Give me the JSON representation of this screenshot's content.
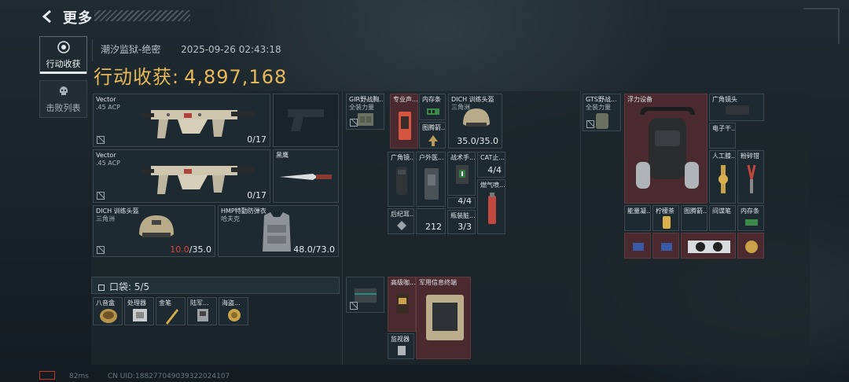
{
  "header": {
    "title": "更多"
  },
  "tabs": [
    {
      "label": "行动收获",
      "icon": "target-icon",
      "active": true
    },
    {
      "label": "击败列表",
      "icon": "skull-icon",
      "active": false
    }
  ],
  "match": {
    "map": "潮汐监狱-绝密",
    "timestamp": "2025-09-26 02:43:18"
  },
  "harvest": {
    "label": "行动收获:",
    "value": "4,897,168"
  },
  "loadout": {
    "primary1": {
      "name": "Vector",
      "ammo": ".45 ACP",
      "count": "0/17",
      "icon": "smg-icon"
    },
    "pistol": {
      "name": "",
      "icon": "pistol-icon"
    },
    "primary2": {
      "name": "Vector",
      "ammo": ".45 ACP",
      "count": "0/17",
      "icon": "smg-icon"
    },
    "melee": {
      "name": "黑鹰",
      "icon": "knife-icon"
    },
    "helmet": {
      "name": "DICH 训练头盔",
      "sub": "三角洲",
      "durability_current": "10.0",
      "durability_max": "/35.0",
      "icon": "helmet-icon"
    },
    "armor": {
      "name": "HMP特勤防弹衣",
      "sub": "哈夫克",
      "durability": "48.0/73.0",
      "icon": "armor-vest-icon"
    }
  },
  "pocket": {
    "label": "口袋: 5/5",
    "items": [
      {
        "name": "八音盒",
        "icon": "music-box-icon"
      },
      {
        "name": "处理器",
        "icon": "processor-icon"
      },
      {
        "name": "金笔",
        "icon": "gold-pen-icon"
      },
      {
        "name": "陆军...",
        "icon": "radio-icon"
      },
      {
        "name": "海盗...",
        "icon": "coin-icon"
      }
    ]
  },
  "chest_rig": {
    "title": "GIR野战胸...",
    "sub": "全装力量",
    "items": [
      {
        "name": "专业声...",
        "icon": "phone-icon"
      },
      {
        "name": "内存条",
        "icon": "ram-icon"
      },
      {
        "name": "图腾箭...",
        "icon": "arrow-icon"
      },
      {
        "name": "DICH 训练头盔",
        "sub": "三角洲",
        "count": "35.0/35.0",
        "icon": "helmet-icon"
      },
      {
        "name": "广角镜...",
        "icon": "lens-icon"
      },
      {
        "name": "户外医...",
        "icon": "medkit-icon"
      },
      {
        "name": "战术手...",
        "icon": "flashlight-icon"
      },
      {
        "name": "CAT止...",
        "count": "4/4",
        "icon": "tourniquet-icon"
      },
      {
        "name": "燃气喷...",
        "icon": "torch-icon"
      },
      {
        "name": "后纪耳...",
        "icon": "earring-icon"
      },
      {
        "name": "",
        "count": "212",
        "icon": "ammo-icon"
      },
      {
        "name": "",
        "count": "4/4",
        "icon": "bandage-icon"
      },
      {
        "name": "瓶装脏...",
        "count": "3/3",
        "icon": "bottle-icon"
      }
    ]
  },
  "backpack": {
    "title": "GTS野战...",
    "sub": "全装力量",
    "items": [
      {
        "name": "浮力设备",
        "icon": "reactor-icon"
      },
      {
        "name": "广角镜头",
        "icon": "lens-icon"
      },
      {
        "name": "电子干...",
        "icon": "jammer-icon"
      },
      {
        "name": "人工膝...",
        "icon": "knee-icon"
      },
      {
        "name": "粉碎钳",
        "icon": "pliers-icon"
      },
      {
        "name": "能量凝...",
        "icon": "gel-icon"
      },
      {
        "name": "柠檬茶",
        "icon": "can-icon"
      },
      {
        "name": "图腾箭...",
        "icon": "arrow-icon"
      },
      {
        "name": "间谍笔",
        "icon": "pen-icon"
      },
      {
        "name": "内存条",
        "icon": "ram-icon"
      },
      {
        "name": "",
        "icon": "usb-icon"
      },
      {
        "name": "",
        "icon": "usb-icon"
      },
      {
        "name": "",
        "icon": "gpu-icon"
      },
      {
        "name": "",
        "icon": "gold-chip-icon"
      }
    ]
  },
  "safe_box": {
    "items": [
      {
        "name": "",
        "icon": "case-icon"
      },
      {
        "name": "高级咖...",
        "icon": "coffee-icon"
      },
      {
        "name": "军用信息终端",
        "icon": "terminal-icon"
      },
      {
        "name": "监视器",
        "icon": "monitor-icon"
      }
    ]
  },
  "footer": {
    "ping": "82ms",
    "uid": "CN UID:188277049039322024107"
  },
  "colors": {
    "accent_gold": "#e8b95a",
    "rare_red": "#4a2a2e",
    "danger": "#e4443c"
  }
}
